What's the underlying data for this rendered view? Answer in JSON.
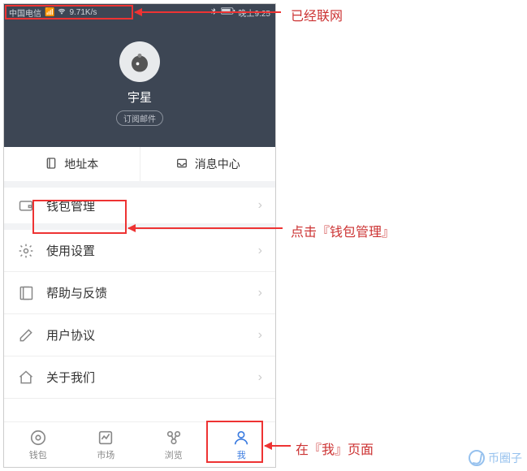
{
  "status": {
    "carrier": "中国电信",
    "speed": "9.71K/s",
    "time": "晚上9:25"
  },
  "profile": {
    "name": "宇星",
    "badge": "订阅邮件"
  },
  "quick": {
    "address_book": "地址本",
    "message_center": "消息中心"
  },
  "menu": {
    "wallet_manage": "钱包管理",
    "settings": "使用设置",
    "feedback": "帮助与反馈",
    "agreement": "用户协议",
    "about": "关于我们"
  },
  "tabs": {
    "wallet": "钱包",
    "market": "市场",
    "browse": "浏览",
    "me": "我"
  },
  "annotations": {
    "networked": "已经联网",
    "click_wallet": "点击『钱包管理』",
    "on_me_page": "在『我』页面"
  },
  "watermark": "币圈子"
}
